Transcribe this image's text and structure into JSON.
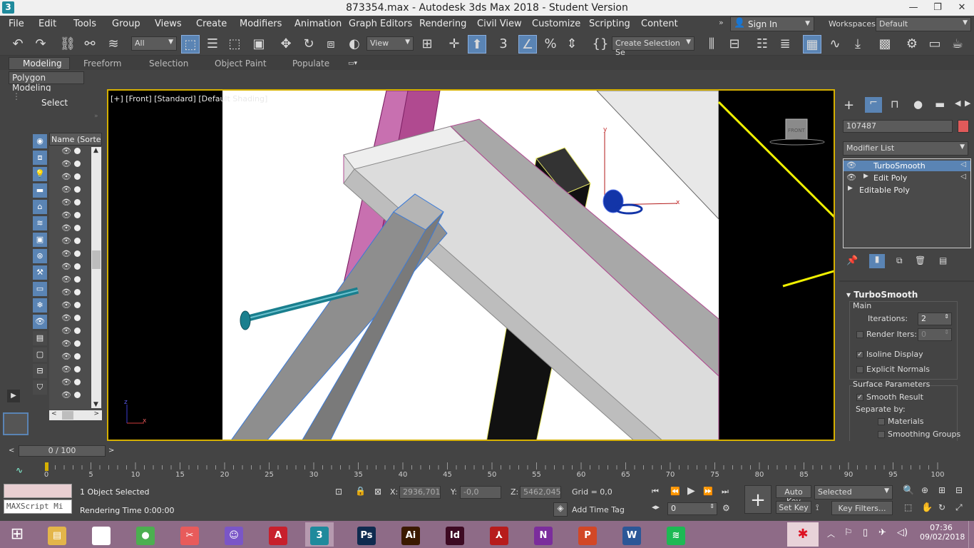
{
  "window": {
    "title": "873354.max - Autodesk 3ds Max 2018 - Student Version",
    "app_icon": "3"
  },
  "menus": [
    "File",
    "Edit",
    "Tools",
    "Group",
    "Views",
    "Create",
    "Modifiers",
    "Animation",
    "Graph Editors",
    "Rendering",
    "Civil View",
    "Customize",
    "Scripting",
    "Content"
  ],
  "signin": {
    "label": "Sign In"
  },
  "workspaces": {
    "label": "Workspaces:",
    "value": "Default"
  },
  "toolbar": {
    "filter_value": "All",
    "refcoord_value": "View",
    "selection_set": "Create Selection Se"
  },
  "ribbon": {
    "tabs": [
      "Modeling",
      "Freeform",
      "Selection",
      "Object Paint",
      "Populate"
    ],
    "panel": "Polygon Modeling"
  },
  "scene_explorer": {
    "title": "Select",
    "column": "Name (Sorted A"
  },
  "viewport": {
    "label": "[+] [Front] [Standard] [Default Shading]",
    "viewcube_face": "FRONT",
    "gizmo_axes": [
      "y",
      "x"
    ],
    "corner_axes": [
      "z",
      "x"
    ]
  },
  "command_panel": {
    "object_name": "107487",
    "object_color": "#e05a5a",
    "modifier_list": "Modifier List",
    "stack": [
      "TurboSmooth",
      "Edit Poly",
      "Editable Poly"
    ],
    "rollout_title": "TurboSmooth",
    "main_label": "Main",
    "iterations_label": "Iterations:",
    "iterations_value": "2",
    "render_iters_label": "Render Iters:",
    "render_iters_value": "0",
    "isoline_label": "Isoline Display",
    "explicit_normals_label": "Explicit Normals",
    "surface_params_label": "Surface Parameters",
    "smooth_result_label": "Smooth Result",
    "separate_by_label": "Separate by:",
    "materials_label": "Materials",
    "smoothing_groups_label": "Smoothing Groups"
  },
  "timeline": {
    "frame": "0 / 100",
    "ticks": [
      "0",
      "5",
      "10",
      "15",
      "20",
      "25",
      "30",
      "35",
      "40",
      "45",
      "50",
      "55",
      "60",
      "65",
      "70",
      "75",
      "80",
      "85",
      "90",
      "95",
      "100"
    ]
  },
  "status": {
    "maxscript": "MAXScript Mi",
    "selected_text": "1 Object Selected",
    "render_time": "Rendering Time  0:00:00",
    "x_label": "X:",
    "x_value": "2936,701",
    "y_label": "Y:",
    "y_value": "-0,0",
    "z_label": "Z:",
    "z_value": "5462,045",
    "grid": "Grid = 0,0",
    "add_time_tag": "Add Time Tag",
    "auto_key": "Auto Key",
    "set_key": "Set Key",
    "selected_dd": "Selected",
    "key_filters": "Key Filters...",
    "current_frame": "0"
  },
  "taskbar": {
    "apps": [
      {
        "name": "file-explorer",
        "glyph": "▤",
        "color": "#e3b54a"
      },
      {
        "name": "home",
        "glyph": "⌂",
        "color": "#ffffff"
      },
      {
        "name": "chrome",
        "glyph": "●",
        "color": "#4caf50"
      },
      {
        "name": "snipping",
        "glyph": "✂",
        "color": "#e85b5b"
      },
      {
        "name": "cat-app",
        "glyph": "☺",
        "color": "#7a56c7"
      },
      {
        "name": "autocad",
        "glyph": "A",
        "color": "#c8202c"
      },
      {
        "name": "3dsmax",
        "glyph": "3",
        "color": "#1f8a9c"
      },
      {
        "name": "photoshop",
        "glyph": "Ps",
        "color": "#0f2b4f"
      },
      {
        "name": "illustrator",
        "glyph": "Ai",
        "color": "#3b1a00"
      },
      {
        "name": "indesign",
        "glyph": "Id",
        "color": "#3d0a22"
      },
      {
        "name": "acrobat",
        "glyph": "⅄",
        "color": "#b71c1c"
      },
      {
        "name": "onenote",
        "glyph": "N",
        "color": "#7b2d9c"
      },
      {
        "name": "powerpoint",
        "glyph": "P",
        "color": "#d24726"
      },
      {
        "name": "word",
        "glyph": "W",
        "color": "#2b5797"
      },
      {
        "name": "spotify",
        "glyph": "≋",
        "color": "#1db954"
      }
    ],
    "time": "07:36",
    "date": "09/02/2018"
  }
}
